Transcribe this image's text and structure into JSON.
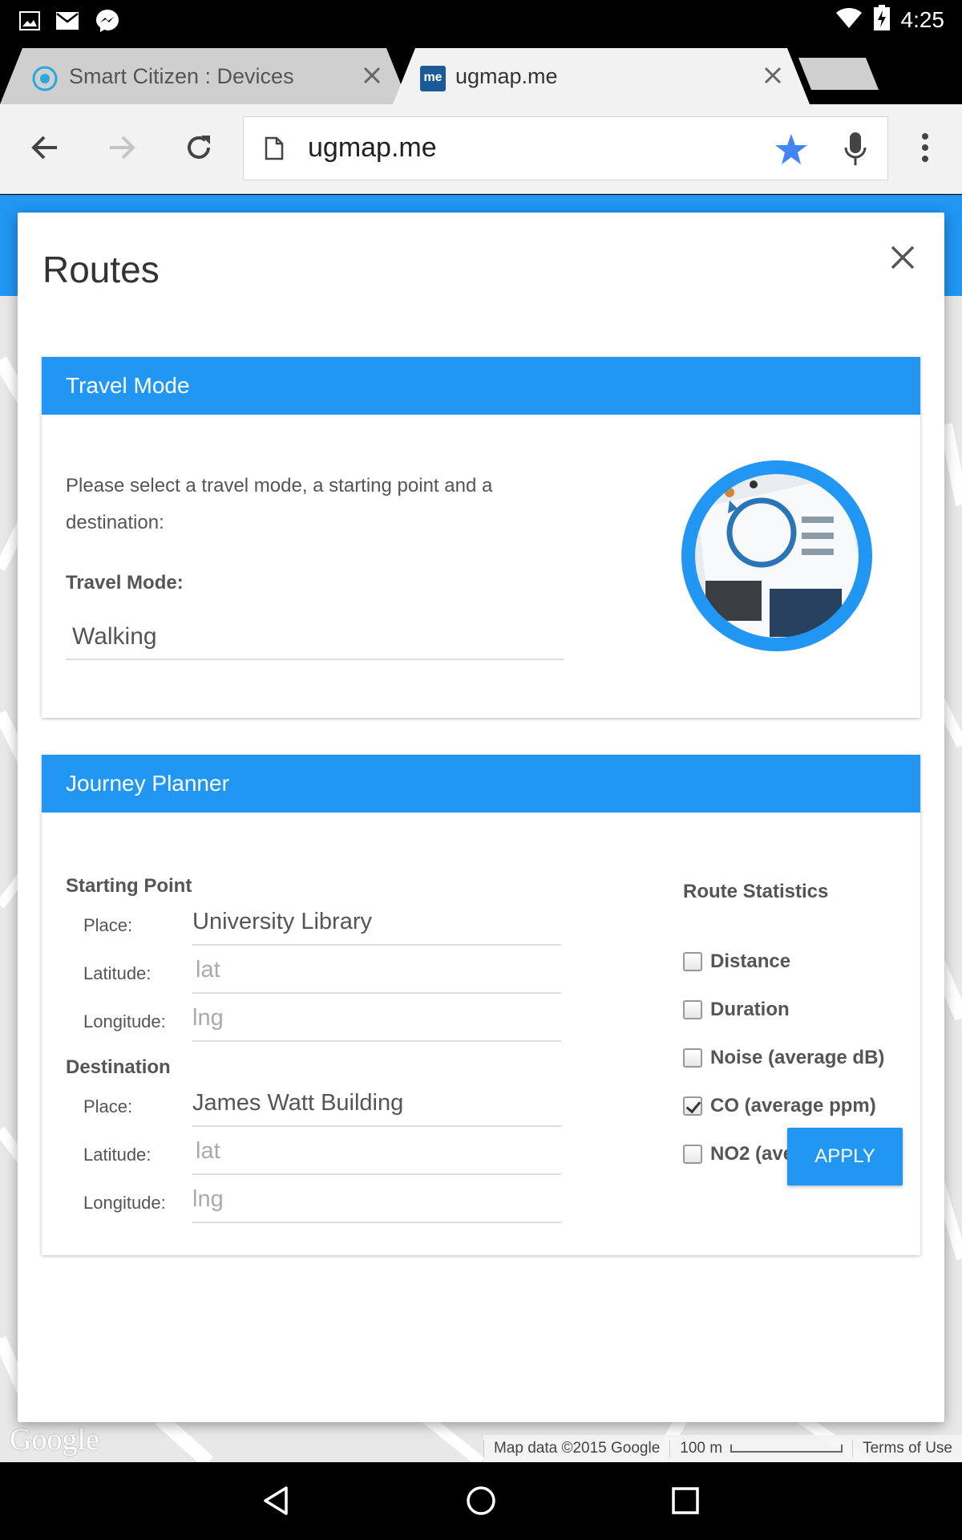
{
  "status_bar": {
    "time": "4:25",
    "left_icons": [
      "image-icon",
      "gmail-icon",
      "messenger-icon"
    ],
    "right_icons": [
      "wifi-icon",
      "battery-charging-icon"
    ]
  },
  "tabs": [
    {
      "title": "Smart Citizen : Devices",
      "active": false
    },
    {
      "title": "ugmap.me",
      "active": true
    }
  ],
  "toolbar": {
    "url": "ugmap.me"
  },
  "map": {
    "logo": "Google",
    "attribution": "Map data ©2015 Google",
    "scale": "100 m",
    "terms": "Terms of Use"
  },
  "modal": {
    "title": "Routes",
    "travel_mode": {
      "heading": "Travel Mode",
      "prompt": "Please select a travel mode, a starting point and a destination:",
      "label": "Travel Mode:",
      "value": "Walking"
    },
    "journey": {
      "heading": "Journey Planner",
      "start": {
        "heading": "Starting Point",
        "place_label": "Place:",
        "place_value": "University Library",
        "lat_label": "Latitude:",
        "lat_placeholder": "lat",
        "lng_label": "Longitude:",
        "lng_placeholder": "lng"
      },
      "destination": {
        "heading": "Destination",
        "place_label": "Place:",
        "place_value": "James Watt Building",
        "lat_label": "Latitude:",
        "lat_placeholder": "lat",
        "lng_label": "Longitude:",
        "lng_placeholder": "lng"
      },
      "stats": {
        "heading": "Route Statistics",
        "options": [
          {
            "label": "Distance",
            "checked": false
          },
          {
            "label": "Duration",
            "checked": false
          },
          {
            "label": "Noise (average dB)",
            "checked": false
          },
          {
            "label": "CO (average ppm)",
            "checked": true
          },
          {
            "label": "NO2 (average ppm)",
            "checked": false
          }
        ]
      }
    },
    "apply_label": "APPLY"
  },
  "colors": {
    "accent": "#2196f3",
    "toolbar_bg": "#f2f2f2",
    "star": "#4285f4"
  }
}
